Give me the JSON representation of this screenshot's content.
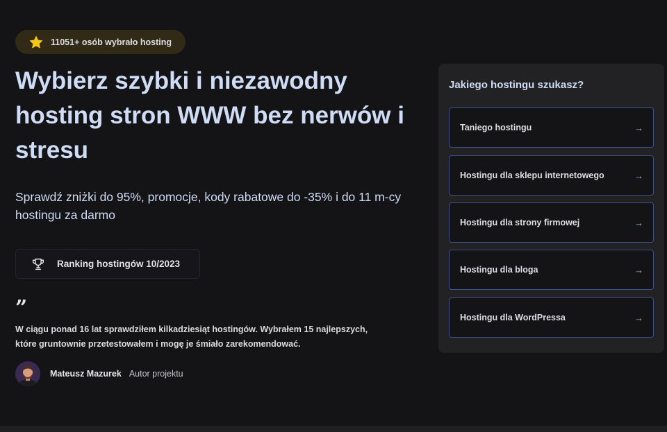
{
  "badge": {
    "icon": "star-icon",
    "text": "11051+ osób wybrało hosting"
  },
  "hero": {
    "title": "Wybierz szybki i niezawodny hosting stron WWW bez nerwów i stresu",
    "subtitle": "Sprawdź zniżki do 95%, promocje, kody rabatowe do -35% i do 11 m-cy hostingu za darmo"
  },
  "ranking": {
    "icon": "trophy-icon",
    "label": "Ranking hostingów 10/2023"
  },
  "quote": {
    "mark": "”",
    "text": "W ciągu ponad 16 lat sprawdziłem kilkadziesiąt hostingów. Wybrałem 15 najlepszych, które gruntownie przetestowałem i mogę je śmiało zarekomendować."
  },
  "author": {
    "name": "Mateusz Mazurek",
    "role": "Autor projektu"
  },
  "panel": {
    "title": "Jakiego hostingu szukasz?",
    "options": [
      {
        "label": "Taniego hostingu",
        "arrow": "→"
      },
      {
        "label": "Hostingu dla sklepu internetowego",
        "arrow": "→"
      },
      {
        "label": "Hostingu dla strony firmowej",
        "arrow": "→"
      },
      {
        "label": "Hostingu dla bloga",
        "arrow": "→"
      },
      {
        "label": "Hostingu dla WordPressa",
        "arrow": "→"
      }
    ]
  },
  "colors": {
    "background": "#141316",
    "heading": "#cfdcf5",
    "panel": "#222225",
    "option_border": "#3e4f8a",
    "arrow": "#9bb2ea",
    "star": "#f5c518",
    "badge_bg": "#302a16"
  }
}
